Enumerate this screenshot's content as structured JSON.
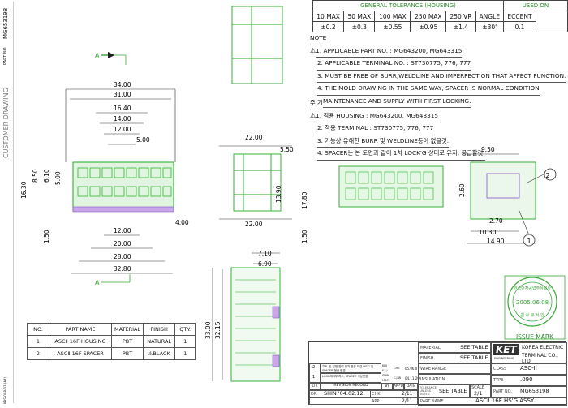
{
  "sidebar": {
    "drawing_no": "MG653198",
    "part_no_label": "PART NO.",
    "customer_drawing": "CUSTOMER DRAWING",
    "bottom_code": "KRS-008-03 (A4)"
  },
  "tolerance": {
    "title": "GENERAL TOLERANCE (HOUSING)",
    "used_on": "USED ON",
    "headers": [
      "10 MAX",
      "50 MAX",
      "100 MAX",
      "250 MAX",
      "250 VR",
      "ANGLE",
      "ECCENT"
    ],
    "values": [
      "±0.2",
      "±0.3",
      "±0.55",
      "±0.95",
      "±1.4",
      "±30'",
      "0.1"
    ]
  },
  "note": {
    "title": "NOTE",
    "lines": [
      "1. APPLICABLE PART NO. : MG643200, MG643315",
      "2. APPLICABLE TERMINAL NO. : ST730775, 776, 777",
      "3. MUST BE FREE OF BURR,WELDLINE AND IMPERFECTION THAT AFFECT FUNCTION.",
      "4. THE MOLD DRAWING IN THE SAME WAY, SPACER IS NORMAL CONDITION",
      "MAINTENANCE AND SUPPLY WITH FIRST LOCKING."
    ]
  },
  "note_kr": {
    "title": "주 기",
    "lines": [
      "1. 적용 HOUSING : MG643200, MG643315",
      "2. 적용 TERMINAL : ST730775, 776, 777",
      "3. 기능상 유해한 BURR 및 WELDLINE등이 없을것.",
      "4. SPACER는 본 도면과 같이 1차 LOCK'G 상태로 유지, 공급할것."
    ]
  },
  "dims": {
    "top": [
      "34.00",
      "31.00",
      "16.40",
      "14.00",
      "12.00",
      "5.00"
    ],
    "bottom": [
      "12.00",
      "20.00",
      "28.00",
      "32.80"
    ],
    "left": [
      "8.50",
      "6.10",
      "5.00",
      "16.30",
      "1.50"
    ],
    "right_front": "4.00",
    "side_top": "22.00",
    "side_bottom": "22.00",
    "side_right": [
      "5.50",
      "13.90",
      "17.80",
      "1.50"
    ],
    "detail": [
      "9.50",
      "2.60",
      "2.70",
      "10.30",
      "14.90"
    ],
    "bottom_view": [
      "7.10",
      "6.90",
      "33.00",
      "32.15"
    ],
    "section_a": "A"
  },
  "callouts": [
    "1",
    "2"
  ],
  "stamp": {
    "lines": [
      "한국단자공업주식회사",
      "2005.06.08",
      "검 사 부 서 인"
    ],
    "issue_mark": "ISSUE MARK"
  },
  "parts_list": {
    "headers": [
      "NO.",
      "PART NAME",
      "MATERIAL",
      "FINISH",
      "QTY."
    ],
    "rows": [
      [
        "1",
        "ASCⅡ 16F HOUSING",
        "PBT",
        "NATURAL",
        "1"
      ],
      [
        "2",
        "ASCⅡ 16F SPACER",
        "PBT",
        "⚠BLACK",
        "1"
      ]
    ]
  },
  "title_block": {
    "material_label": "MATERIAL",
    "material_value": "SEE TABLE",
    "finish_label": "FINISH",
    "finish_value": "SEE TABLE",
    "wire_range_label": "WIRE RANGE",
    "insulation_label": "INSULATION",
    "tolerance_label": "TOLERANCE UNLESS NOTED",
    "tolerance_value": "SEE TABLE",
    "scale_label": "SCALE",
    "scale_value": "2/1",
    "company": "KET",
    "company_sub": "ENGINEERING",
    "company_name_1": "KOREA ELECTRIC",
    "company_name_2": "TERMINAL CO., LTD.",
    "class_label": "CLASS",
    "class_value": "ASC-II",
    "type_label": "TYPE",
    "type_value": ".090",
    "partno_label": "PART NO.",
    "partno_value": "MG653198",
    "part_name_label": "PART NAME",
    "part_name_value": "ASCⅡ 16F HS'G ASSY",
    "rev_label": "LTR",
    "rev_record": "REVISION RECORD",
    "by": "BY",
    "appd": "APP'D",
    "date": "DATE",
    "dr_label": "DR.",
    "dr_value": "SHIN '04.02.12.",
    "chk_label": "CHK.",
    "chk_value": "2/11",
    "app_label": "APP.",
    "app_value": "2/11",
    "rev_rows": [
      {
        "ltr": "2",
        "text": "TML 및 설명 참여 위치 변경 보강\nHS'G 및 SPACER 형상 변경",
        "by": "KDJ",
        "chk": "K.J.J",
        "app": "CHK",
        "date": "05.06.07"
      },
      {
        "ltr": "1",
        "text": "LOCK래치부 치수, SPACER 색상변경",
        "by": "SHIN",
        "chk": "MSC",
        "app": "C.J.W",
        "date": "04.11.29"
      }
    ]
  }
}
